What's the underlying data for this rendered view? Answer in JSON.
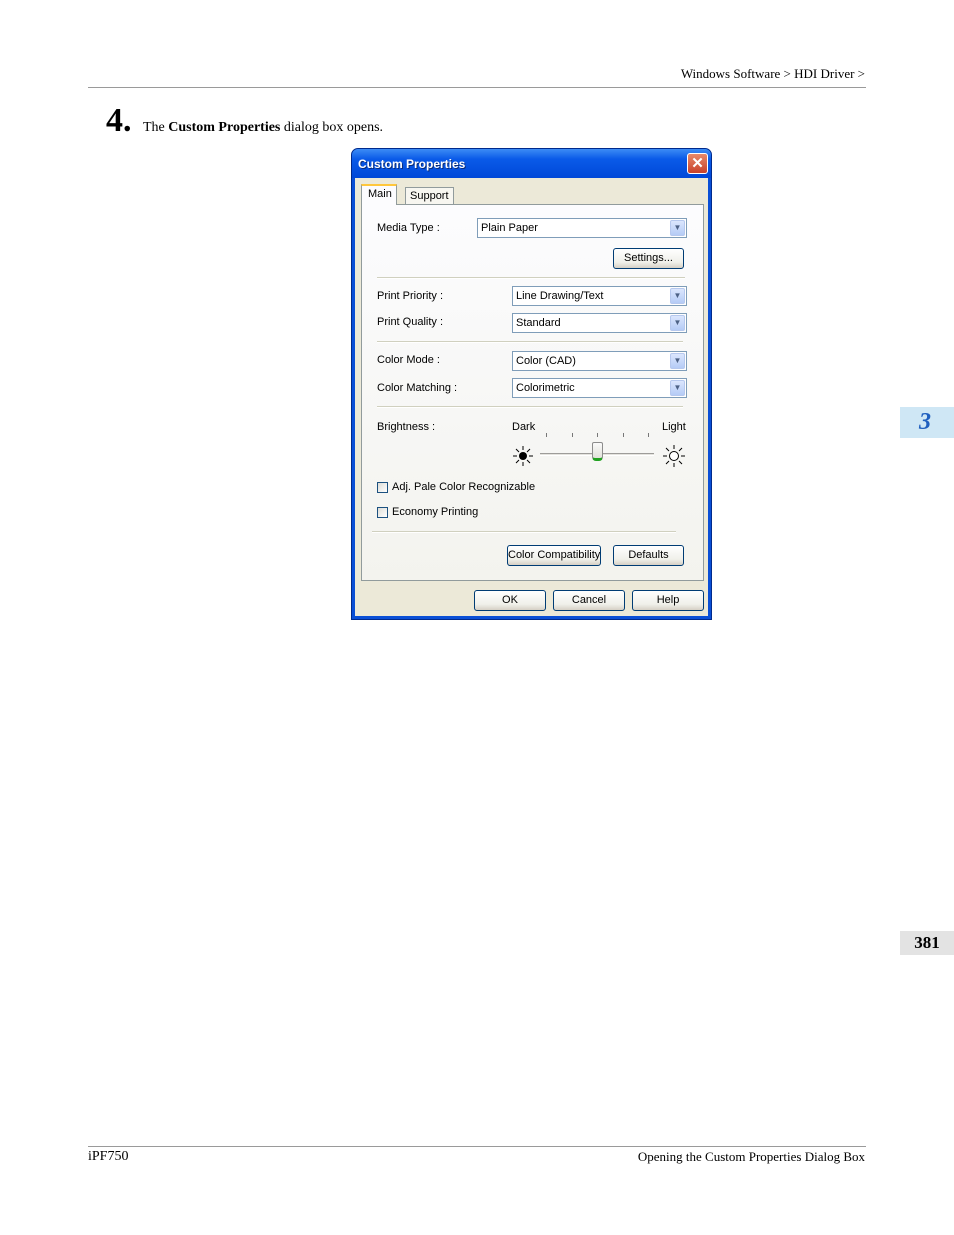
{
  "page": {
    "breadcrumb": "Windows Software > HDI Driver >",
    "step_number": "4.",
    "step_text_pre": "The ",
    "step_text_bold": "Custom Properties",
    "step_text_post": " dialog box opens.",
    "chapter_tab": "3",
    "page_number": "381",
    "footer_left": "iPF750",
    "footer_right": "Opening the Custom Properties Dialog Box"
  },
  "dialog": {
    "title": "Custom Properties",
    "close_glyph": "✕",
    "tabs": [
      {
        "label": "Main",
        "active": true
      },
      {
        "label": "Support",
        "active": false
      }
    ],
    "media_type": {
      "label": "Media Type :",
      "value": "Plain Paper"
    },
    "settings_button": "Settings...",
    "print_priority": {
      "label": "Print Priority :",
      "value": "Line Drawing/Text"
    },
    "print_quality": {
      "label": "Print Quality :",
      "value": "Standard"
    },
    "color_mode": {
      "label": "Color Mode :",
      "value": "Color (CAD)"
    },
    "color_matching": {
      "label": "Color Matching :",
      "value": "Colorimetric"
    },
    "brightness": {
      "label": "Brightness :",
      "min_label": "Dark",
      "max_label": "Light",
      "level": 0.5,
      "dark_icon": "sun-dark-icon",
      "light_icon": "sun-light-icon"
    },
    "checkboxes": [
      {
        "label": "Adj. Pale Color Recognizable",
        "checked": false
      },
      {
        "label": "Economy Printing",
        "checked": false
      }
    ],
    "color_compat_button": "Color Compatibility",
    "defaults_button": "Defaults",
    "ok_button": "OK",
    "cancel_button": "Cancel",
    "help_button": "Help",
    "dropdown_glyph": "▼",
    "colors": {
      "titlebar": "#0a5ae8",
      "client": "#ece9d8",
      "active_tab_accent": "#ffc73c"
    }
  }
}
